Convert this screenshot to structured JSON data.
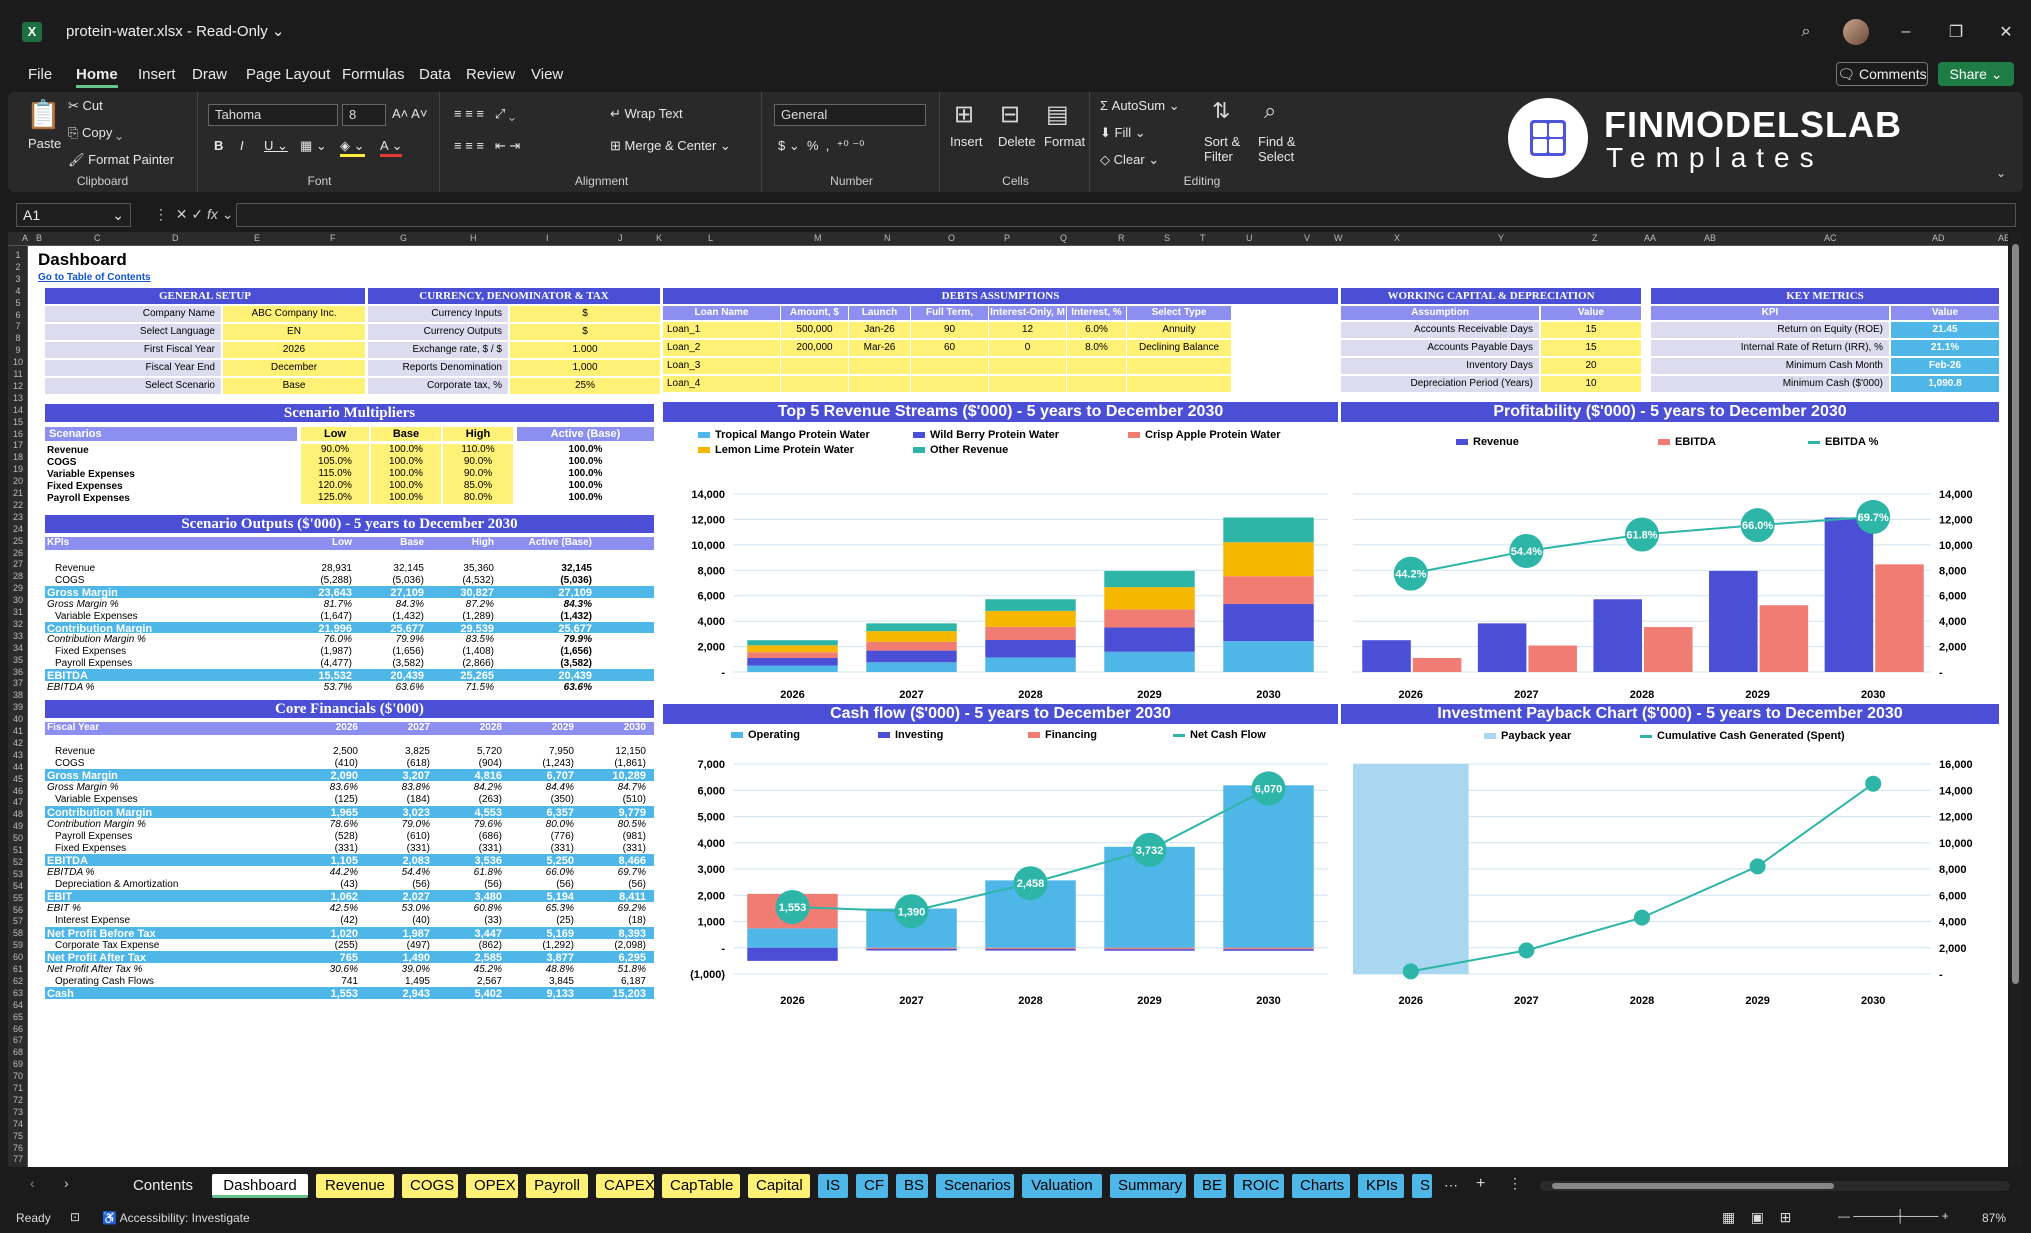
{
  "window": {
    "file_title": "protein-water.xlsx",
    "mode": "Read-Only",
    "app_icon": "X"
  },
  "menu": [
    "File",
    "Home",
    "Insert",
    "Draw",
    "Page Layout",
    "Formulas",
    "Data",
    "Review",
    "View"
  ],
  "menu_active": "Home",
  "buttons": {
    "comments": "Comments",
    "share": "Share"
  },
  "ribbon": {
    "paste": "Paste",
    "cut": "Cut",
    "copy": "Copy",
    "format_painter": "Format Painter",
    "clipboard": "Clipboard",
    "font_name": "Tahoma",
    "font_size": "8",
    "font": "Font",
    "wrap": "Wrap Text",
    "merge": "Merge & Center",
    "alignment": "Alignment",
    "numfmt": "General",
    "number": "Number",
    "insert": "Insert",
    "delete": "Delete",
    "format": "Format",
    "cells": "Cells",
    "autosum": "AutoSum",
    "fill": "Fill",
    "clear": "Clear",
    "sort": "Sort & Filter",
    "find": "Find & Select",
    "editing": "Editing"
  },
  "logo": {
    "line1": "FINMODELSLAB",
    "line2": "Templates"
  },
  "namebox": "A1",
  "dashboard": {
    "title": "Dashboard",
    "toc": "Go to Table of Contents"
  },
  "general": {
    "title": "GENERAL SETUP",
    "rows": [
      [
        "Company Name",
        "ABC Company Inc."
      ],
      [
        "Select Language",
        "EN"
      ],
      [
        "First Fiscal Year",
        "2026"
      ],
      [
        "Fiscal Year End",
        "December"
      ],
      [
        "Select Scenario",
        "Base"
      ]
    ]
  },
  "currency": {
    "title": "CURRENCY, DENOMINATOR & TAX",
    "rows": [
      [
        "Currency Inputs",
        "$"
      ],
      [
        "Currency Outputs",
        "$"
      ],
      [
        "Exchange rate, $ / $",
        "1.000"
      ],
      [
        "Reports Denomination",
        "1,000"
      ],
      [
        "Corporate tax, %",
        "25%"
      ]
    ]
  },
  "debts": {
    "title": "DEBTS ASSUMPTIONS",
    "headers": [
      "Loan Name",
      "Amount, $",
      "Launch",
      "Full Term, Months",
      "Interest-Only, M",
      "Interest, %",
      "Select Type"
    ],
    "rows": [
      [
        "Loan_1",
        "500,000",
        "Jan-26",
        "90",
        "12",
        "6.0%",
        "Annuity"
      ],
      [
        "Loan_2",
        "200,000",
        "Mar-26",
        "60",
        "0",
        "8.0%",
        "Declining Balance"
      ],
      [
        "Loan_3",
        "",
        "",
        "",
        "",
        "",
        ""
      ],
      [
        "Loan_4",
        "",
        "",
        "",
        "",
        "",
        ""
      ]
    ]
  },
  "wc": {
    "title": "WORKING CAPITAL & DEPRECIATION",
    "headers": [
      "Assumption",
      "Value"
    ],
    "rows": [
      [
        "Accounts Receivable Days",
        "15"
      ],
      [
        "Accounts Payable Days",
        "15"
      ],
      [
        "Inventory Days",
        "20"
      ],
      [
        "Depreciation Period (Years)",
        "10"
      ]
    ]
  },
  "kpi": {
    "title": "KEY METRICS",
    "headers": [
      "KPI",
      "Value"
    ],
    "rows": [
      [
        "Return on Equity (ROE)",
        "21.45"
      ],
      [
        "Internal Rate of Return (IRR), %",
        "21.1%"
      ],
      [
        "Minimum Cash Month",
        "Feb-26"
      ],
      [
        "Minimum Cash ($'000)",
        "1,090.8"
      ]
    ]
  },
  "multipliers": {
    "title": "Scenario Multipliers",
    "headers": [
      "Scenarios",
      "Low",
      "Base",
      "High",
      "Active (Base)"
    ],
    "rows": [
      [
        "Revenue",
        "90.0%",
        "100.0%",
        "110.0%",
        "100.0%"
      ],
      [
        "COGS",
        "105.0%",
        "100.0%",
        "90.0%",
        "100.0%"
      ],
      [
        "Variable Expenses",
        "115.0%",
        "100.0%",
        "90.0%",
        "100.0%"
      ],
      [
        "Fixed Expenses",
        "120.0%",
        "100.0%",
        "85.0%",
        "100.0%"
      ],
      [
        "Payroll Expenses",
        "125.0%",
        "100.0%",
        "80.0%",
        "100.0%"
      ]
    ]
  },
  "outputs": {
    "title": "Scenario Outputs ($'000) - 5 years to December 2030",
    "headers": [
      "KPIs",
      "Low",
      "Base",
      "High",
      "Active (Base)"
    ],
    "rows": [
      {
        "k": "Revenue",
        "v": [
          "28,931",
          "32,145",
          "35,360",
          "32,145"
        ],
        "t": "n"
      },
      {
        "k": "COGS",
        "v": [
          "(5,288)",
          "(5,036)",
          "(4,532)",
          "(5,036)"
        ],
        "t": "n"
      },
      {
        "k": "Gross Margin",
        "v": [
          "23,643",
          "27,109",
          "30,827",
          "27,109"
        ],
        "t": "b"
      },
      {
        "k": "Gross Margin %",
        "v": [
          "81.7%",
          "84.3%",
          "87.2%",
          "84.3%"
        ],
        "t": "i"
      },
      {
        "k": "Variable Expenses",
        "v": [
          "(1,647)",
          "(1,432)",
          "(1,289)",
          "(1,432)"
        ],
        "t": "n"
      },
      {
        "k": "Contribution Margin",
        "v": [
          "21,996",
          "25,677",
          "29,539",
          "25,677"
        ],
        "t": "b"
      },
      {
        "k": "Contribution Margin %",
        "v": [
          "76.0%",
          "79.9%",
          "83.5%",
          "79.9%"
        ],
        "t": "i"
      },
      {
        "k": "Fixed Expenses",
        "v": [
          "(1,987)",
          "(1,656)",
          "(1,408)",
          "(1,656)"
        ],
        "t": "n"
      },
      {
        "k": "Payroll Expenses",
        "v": [
          "(4,477)",
          "(3,582)",
          "(2,866)",
          "(3,582)"
        ],
        "t": "n"
      },
      {
        "k": "EBITDA",
        "v": [
          "15,532",
          "20,439",
          "25,265",
          "20,439"
        ],
        "t": "b"
      },
      {
        "k": "EBITDA %",
        "v": [
          "53.7%",
          "63.6%",
          "71.5%",
          "63.6%"
        ],
        "t": "i"
      }
    ]
  },
  "core": {
    "title": "Core Financials ($'000)",
    "headers": [
      "Fiscal Year",
      "2026",
      "2027",
      "2028",
      "2029",
      "2030"
    ],
    "rows": [
      {
        "k": "Revenue",
        "v": [
          "2,500",
          "3,825",
          "5,720",
          "7,950",
          "12,150"
        ],
        "t": "n"
      },
      {
        "k": "COGS",
        "v": [
          "(410)",
          "(618)",
          "(904)",
          "(1,243)",
          "(1,861)"
        ],
        "t": "n"
      },
      {
        "k": "Gross Margin",
        "v": [
          "2,090",
          "3,207",
          "4,816",
          "6,707",
          "10,289"
        ],
        "t": "b"
      },
      {
        "k": "Gross Margin %",
        "v": [
          "83.6%",
          "83.8%",
          "84.2%",
          "84.4%",
          "84.7%"
        ],
        "t": "i"
      },
      {
        "k": "Variable Expenses",
        "v": [
          "(125)",
          "(184)",
          "(263)",
          "(350)",
          "(510)"
        ],
        "t": "n"
      },
      {
        "k": "Contribution Margin",
        "v": [
          "1,965",
          "3,023",
          "4,553",
          "6,357",
          "9,779"
        ],
        "t": "b"
      },
      {
        "k": "Contribution Margin %",
        "v": [
          "78.6%",
          "79.0%",
          "79.6%",
          "80.0%",
          "80.5%"
        ],
        "t": "i"
      },
      {
        "k": "Payroll Expenses",
        "v": [
          "(528)",
          "(610)",
          "(686)",
          "(776)",
          "(981)"
        ],
        "t": "n"
      },
      {
        "k": "Fixed Expenses",
        "v": [
          "(331)",
          "(331)",
          "(331)",
          "(331)",
          "(331)"
        ],
        "t": "n"
      },
      {
        "k": "EBITDA",
        "v": [
          "1,105",
          "2,083",
          "3,536",
          "5,250",
          "8,466"
        ],
        "t": "b"
      },
      {
        "k": "EBITDA %",
        "v": [
          "44.2%",
          "54.4%",
          "61.8%",
          "66.0%",
          "69.7%"
        ],
        "t": "i"
      },
      {
        "k": "Depreciation & Amortization",
        "v": [
          "(43)",
          "(56)",
          "(56)",
          "(56)",
          "(56)"
        ],
        "t": "n"
      },
      {
        "k": "EBIT",
        "v": [
          "1,062",
          "2,027",
          "3,480",
          "5,194",
          "8,411"
        ],
        "t": "b"
      },
      {
        "k": "EBIT %",
        "v": [
          "42.5%",
          "53.0%",
          "60.8%",
          "65.3%",
          "69.2%"
        ],
        "t": "i"
      },
      {
        "k": "Interest Expense",
        "v": [
          "(42)",
          "(40)",
          "(33)",
          "(25)",
          "(18)"
        ],
        "t": "n"
      },
      {
        "k": "Net Profit Before Tax",
        "v": [
          "1,020",
          "1,987",
          "3,447",
          "5,169",
          "8,393"
        ],
        "t": "b"
      },
      {
        "k": "Corporate Tax Expense",
        "v": [
          "(255)",
          "(497)",
          "(862)",
          "(1,292)",
          "(2,098)"
        ],
        "t": "n"
      },
      {
        "k": "Net Profit After Tax",
        "v": [
          "765",
          "1,490",
          "2,585",
          "3,877",
          "6,295"
        ],
        "t": "b"
      },
      {
        "k": "Net Profit After Tax %",
        "v": [
          "30.6%",
          "39.0%",
          "45.2%",
          "48.8%",
          "51.8%"
        ],
        "t": "i"
      },
      {
        "k": "Operating Cash Flows",
        "v": [
          "741",
          "1,495",
          "2,567",
          "3,845",
          "6,187"
        ],
        "t": "n"
      },
      {
        "k": "Cash",
        "v": [
          "1,553",
          "2,943",
          "5,402",
          "9,133",
          "15,203"
        ],
        "t": "b"
      }
    ]
  },
  "chart_data": [
    {
      "type": "bar",
      "title": "Top 5 Revenue Streams ($'000) - 5 years to December 2030",
      "categories": [
        "2026",
        "2027",
        "2028",
        "2029",
        "2030"
      ],
      "ylim": [
        0,
        14000
      ],
      "series": [
        {
          "name": "Tropical Mango Protein Water",
          "color": "#4fb6e8",
          "values": [
            500,
            765,
            1144,
            1590,
            2430
          ]
        },
        {
          "name": "Wild Berry Protein Water",
          "color": "#4b4fd6",
          "values": [
            600,
            918,
            1373,
            1908,
            2916
          ]
        },
        {
          "name": "Crisp Apple Protein Water",
          "color": "#f07c74",
          "values": [
            450,
            689,
            1030,
            1431,
            2187
          ]
        },
        {
          "name": "Lemon Lime Protein Water",
          "color": "#f5b700",
          "values": [
            550,
            842,
            1258,
            1749,
            2673
          ]
        },
        {
          "name": "Other Revenue",
          "color": "#2db5a8",
          "values": [
            400,
            612,
            915,
            1272,
            1944
          ]
        }
      ]
    },
    {
      "type": "bar",
      "title": "Profitability ($'000) - 5 years to December 2030",
      "categories": [
        "2026",
        "2027",
        "2028",
        "2029",
        "2030"
      ],
      "ylim": [
        0,
        14000
      ],
      "series": [
        {
          "name": "Revenue",
          "color": "#4b4fd6",
          "values": [
            2500,
            3825,
            5720,
            7950,
            12150
          ]
        },
        {
          "name": "EBITDA",
          "color": "#f07c74",
          "values": [
            1105,
            2083,
            3536,
            5250,
            8466
          ]
        },
        {
          "name": "EBITDA %",
          "color": "#2db5a8",
          "values": [
            44.2,
            54.4,
            61.8,
            66.0,
            69.7
          ],
          "labels": [
            "44.2%",
            "54.4%",
            "61.8%",
            "66.0%",
            "69.7%"
          ]
        }
      ]
    },
    {
      "type": "bar",
      "title": "Cash flow ($'000) - 5 years to December 2030",
      "categories": [
        "2026",
        "2027",
        "2028",
        "2029",
        "2030"
      ],
      "ylim": [
        -1000,
        7000
      ],
      "series": [
        {
          "name": "Operating",
          "color": "#4fb6e8",
          "values": [
            741,
            1495,
            2567,
            3845,
            6187
          ]
        },
        {
          "name": "Investing",
          "color": "#4b4fd6",
          "values": [
            -500,
            -60,
            -60,
            -60,
            -60
          ]
        },
        {
          "name": "Financing",
          "color": "#f07c74",
          "values": [
            1312,
            -45,
            -48,
            -54,
            -57
          ]
        },
        {
          "name": "Net Cash Flow",
          "color": "#2db5a8",
          "values": [
            1553,
            1390,
            2458,
            3732,
            6070
          ],
          "labels": [
            "1,553",
            "1,390",
            "2,458",
            "3,732",
            "6,070"
          ]
        }
      ]
    },
    {
      "type": "line",
      "title": "Investment Payback Chart ($'000) - 5 years to December 2030",
      "categories": [
        "2026",
        "2027",
        "2028",
        "2029",
        "2030"
      ],
      "ylim": [
        0,
        16000
      ],
      "series": [
        {
          "name": "Payback year",
          "color": "#a9d6f0",
          "values": [
            1,
            0,
            0,
            0,
            0
          ]
        },
        {
          "name": "Cumulative Cash Generated (Spent)",
          "color": "#2db5a8",
          "values": [
            200,
            1800,
            4300,
            8200,
            14500
          ]
        }
      ]
    }
  ],
  "tabs": [
    {
      "label": "Contents",
      "style": "dark"
    },
    {
      "label": "Dashboard",
      "style": "active"
    },
    {
      "label": "Revenue",
      "style": "yellow"
    },
    {
      "label": "COGS",
      "style": "yellow"
    },
    {
      "label": "OPEX",
      "style": "yellow"
    },
    {
      "label": "Payroll",
      "style": "yellow"
    },
    {
      "label": "CAPEX",
      "style": "yellow"
    },
    {
      "label": "CapTable",
      "style": "yellow"
    },
    {
      "label": "Capital",
      "style": "yellow"
    },
    {
      "label": "IS",
      "style": "blue"
    },
    {
      "label": "CF",
      "style": "blue"
    },
    {
      "label": "BS",
      "style": "blue"
    },
    {
      "label": "Scenarios",
      "style": "blue"
    },
    {
      "label": "Valuation",
      "style": "blue"
    },
    {
      "label": "Summary",
      "style": "blue"
    },
    {
      "label": "BE",
      "style": "blue"
    },
    {
      "label": "ROIC",
      "style": "blue"
    },
    {
      "label": "Charts",
      "style": "blue"
    },
    {
      "label": "KPIs",
      "style": "blue"
    },
    {
      "label": "S",
      "style": "blue"
    }
  ],
  "status": {
    "ready": "Ready",
    "accessibility": "Accessibility: Investigate",
    "zoom": "87%"
  }
}
